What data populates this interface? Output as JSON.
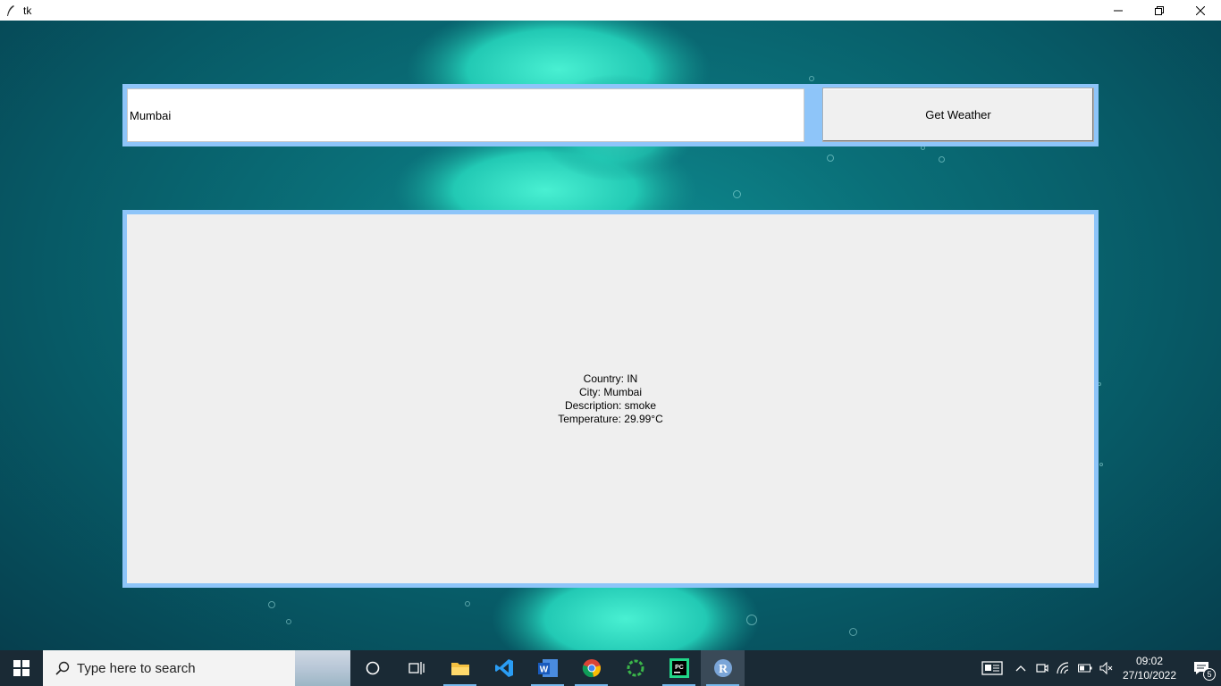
{
  "window": {
    "title": "tk",
    "controls": {
      "minimize": "minimize",
      "maximize": "restore",
      "close": "close"
    }
  },
  "form": {
    "city_value": "Mumbai",
    "button_label": "Get Weather"
  },
  "result": {
    "lines": [
      "Country: IN",
      "City: Mumbai",
      "Description: smoke",
      "Temperature: 29.99°C"
    ]
  },
  "taskbar": {
    "search_placeholder": "Type here to search",
    "pinned": [
      "cortana-icon",
      "task-view-icon",
      "file-explorer-icon",
      "vscode-icon",
      "word-icon",
      "chrome-icon",
      "spinner-app-icon",
      "pycharm-icon",
      "r-icon"
    ],
    "clock_time": "09:02",
    "clock_date": "27/10/2022",
    "notification_count": "5"
  },
  "colors": {
    "frame_border": "#8ec5f9",
    "panel_bg": "#efefef",
    "taskbar_bg": "#1a2a35"
  }
}
